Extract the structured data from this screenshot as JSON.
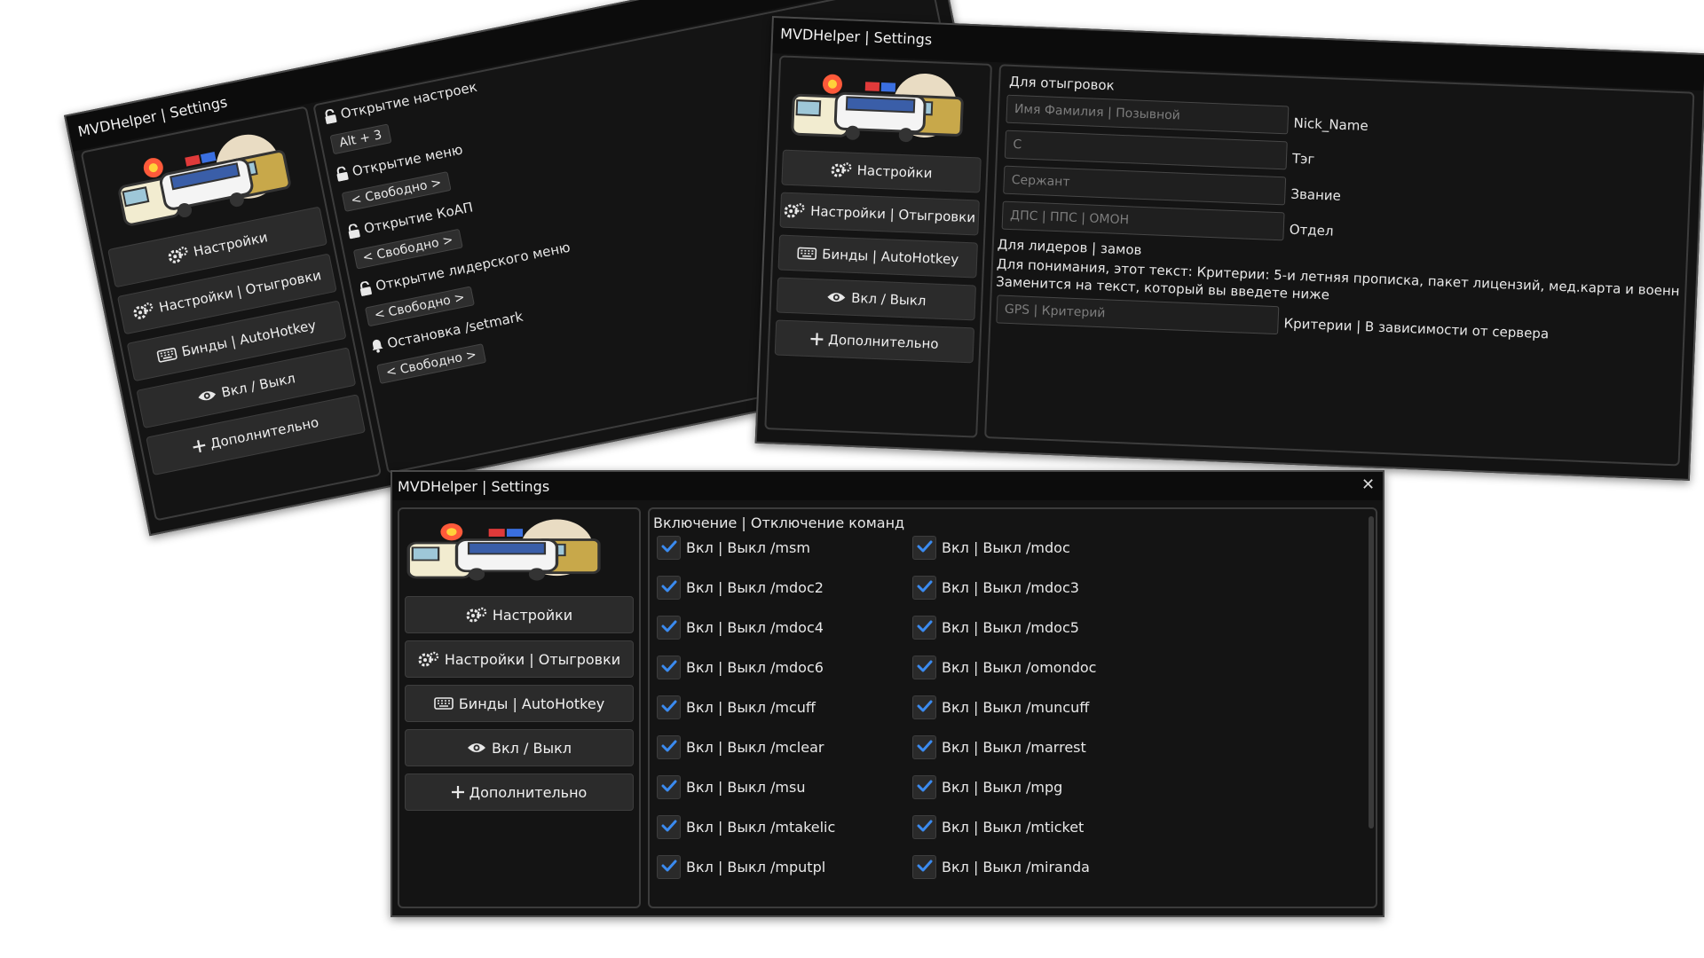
{
  "colors": {
    "window_bg": "#131313",
    "panel_border": "#3c3c3c",
    "button_bg": "#2b2b2b",
    "check_accent": "#3b8bf0"
  },
  "app_title": "MVDHelper | Settings",
  "close_glyph": "✕",
  "sidebar": {
    "settings": "Настройки",
    "rp_settings": "Настройки | Отыгровки",
    "binds": "Бинды | AutoHotkey",
    "toggle": "Вкл / Выкл",
    "extra": "Дополнительно"
  },
  "icons": {
    "settings": "gears-icon",
    "binds": "keyboard-icon",
    "toggle": "eye-icon",
    "extra": "plus-icon",
    "lock": "lock-icon",
    "bell": "bell-icon",
    "check": "check-icon"
  },
  "win_left": {
    "items": [
      {
        "label": "Открытие настроек",
        "key": "Alt + 3"
      },
      {
        "label": "Открытие меню",
        "key": "< Свободно >"
      },
      {
        "label": "Открытие КоАП",
        "key": "< Свободно >"
      },
      {
        "label": "Открытие лидерского меню",
        "key": "< Свободно >"
      },
      {
        "label": "Остановка /setmark",
        "key": "< Свободно >"
      }
    ]
  },
  "win_right": {
    "section_title": "Для отыгровок",
    "fields": [
      {
        "placeholder": "Имя Фамилия | Позывной",
        "label": "Nick_Name"
      },
      {
        "placeholder": "C",
        "label": "Тэг"
      },
      {
        "placeholder": "Сержант",
        "label": "Звание"
      },
      {
        "placeholder": "ДПС | ППС | ОМОН",
        "label": "Отдел"
      }
    ],
    "leaders_title": "Для лидеров | замов",
    "note_line1": "Для понимания, этот текст: Критерии: 5-и летняя прописка, пакет лицензий, мед.карта и военн",
    "note_line2": "Заменится на текст, который вы введете ниже",
    "criteria_placeholder": "GPS | Критерий",
    "criteria_label": "Критерии | В зависимости от сервера"
  },
  "win_bottom": {
    "section_title": "Включение | Отключение команд",
    "left_cmds": [
      "Вкл | Выкл /msm",
      "Вкл | Выкл /mdoc2",
      "Вкл | Выкл /mdoc4",
      "Вкл | Выкл /mdoc6",
      "Вкл | Выкл /mcuff",
      "Вкл | Выкл /mclear",
      "Вкл | Выкл /msu",
      "Вкл | Выкл /mtakelic",
      "Вкл | Выкл /mputpl"
    ],
    "right_cmds": [
      "Вкл | Выкл /mdoc",
      "Вкл | Выкл /mdoc3",
      "Вкл | Выкл /mdoc5",
      "Вкл | Выкл /omondoc",
      "Вкл | Выкл /muncuff",
      "Вкл | Выкл /marrest",
      "Вкл | Выкл /mpg",
      "Вкл | Выкл /mticket",
      "Вкл | Выкл /miranda"
    ],
    "checked": true
  }
}
